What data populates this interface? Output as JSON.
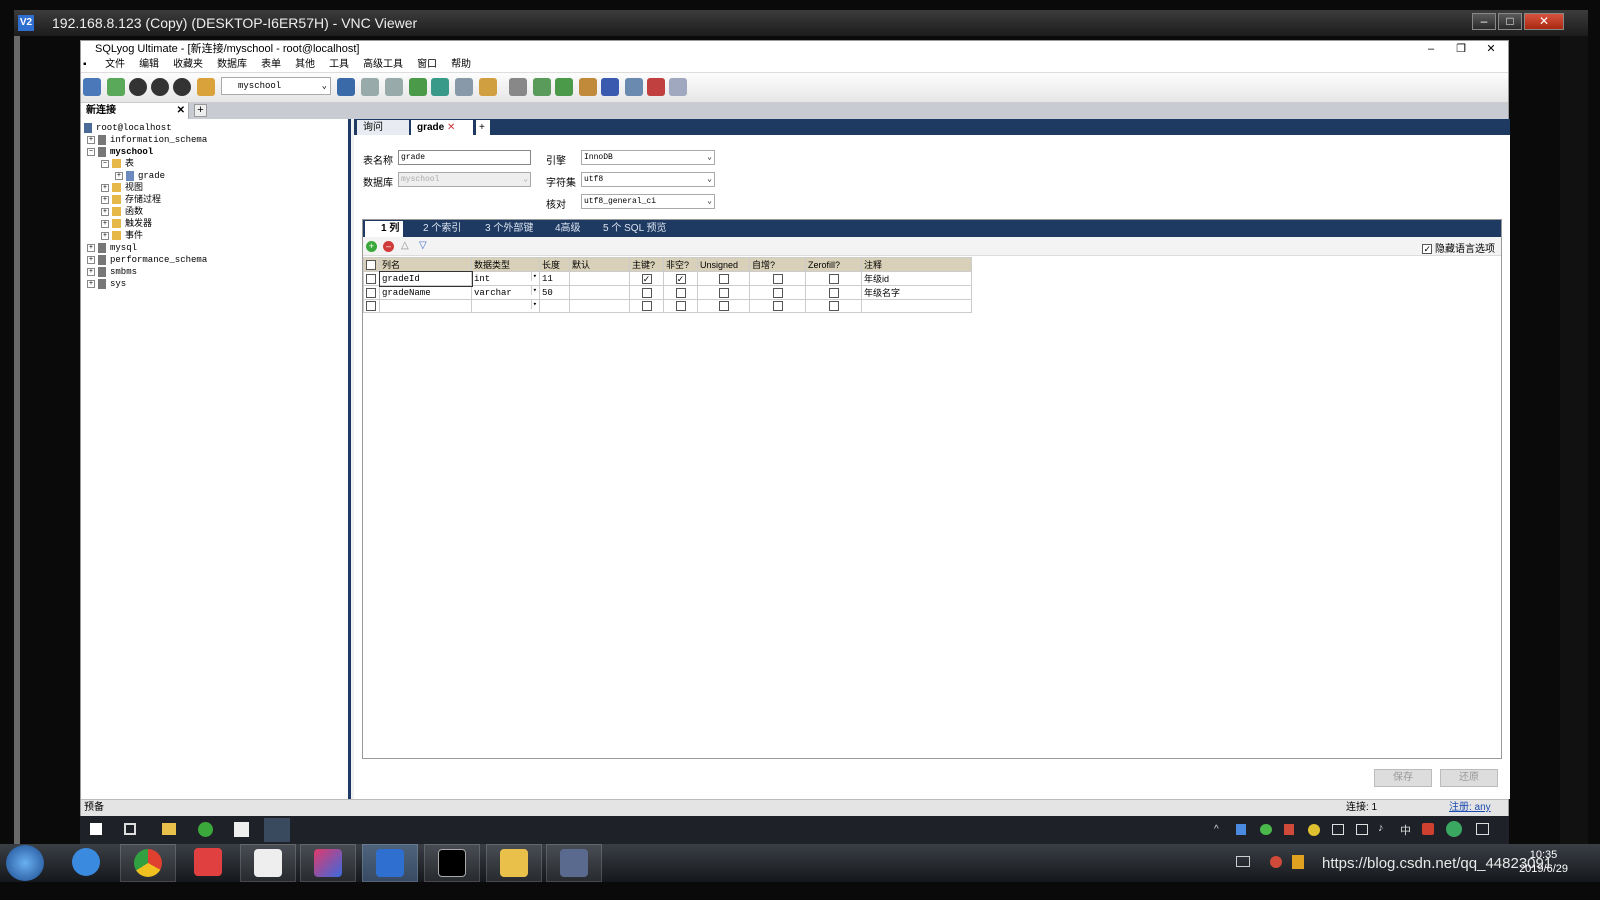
{
  "vnc": {
    "title": "192.168.8.123 (Copy) (DESKTOP-I6ER57H) - VNC Viewer",
    "icon": "V2"
  },
  "app": {
    "title": "SQLyog Ultimate - [新连接/myschool - root@localhost]",
    "menu": [
      "文件",
      "编辑",
      "收藏夹",
      "数据库",
      "表单",
      "其他",
      "工具",
      "高级工具",
      "窗口",
      "帮助"
    ],
    "db_selector": "myschool",
    "connection_tab": "新连接"
  },
  "tree": {
    "root": "root@localhost",
    "nodes": [
      {
        "label": "information_schema",
        "level": 1,
        "bold": false
      },
      {
        "label": "myschool",
        "level": 1,
        "bold": true
      },
      {
        "label": "表",
        "level": 2,
        "bold": false
      },
      {
        "label": "grade",
        "level": 3,
        "bold": false
      },
      {
        "label": "视图",
        "level": 2,
        "bold": false
      },
      {
        "label": "存储过程",
        "level": 2,
        "bold": false
      },
      {
        "label": "函数",
        "level": 2,
        "bold": false
      },
      {
        "label": "触发器",
        "level": 2,
        "bold": false
      },
      {
        "label": "事件",
        "level": 2,
        "bold": false
      },
      {
        "label": "mysql",
        "level": 1,
        "bold": false
      },
      {
        "label": "performance_schema",
        "level": 1,
        "bold": false
      },
      {
        "label": "smbms",
        "level": 1,
        "bold": false
      },
      {
        "label": "sys",
        "level": 1,
        "bold": false
      }
    ]
  },
  "query_tabs": [
    {
      "label": "询问"
    },
    {
      "label": "grade"
    }
  ],
  "form": {
    "table_name_label": "表名称",
    "table_name": "grade",
    "database_label": "数据库",
    "database": "myschool",
    "engine_label": "引擎",
    "engine": "InnoDB",
    "charset_label": "字符集",
    "charset": "utf8",
    "collation_label": "核对",
    "collation": "utf8_general_ci"
  },
  "subtabs": [
    "1 列",
    "2 个索引",
    "3 个外部键",
    "4高级",
    "5 个 SQL 预览"
  ],
  "hide_lang_option": "隐藏语言选项",
  "columns": {
    "headers": [
      "列名",
      "数据类型",
      "长度",
      "默认",
      "主键?",
      "非空?",
      "Unsigned",
      "自增?",
      "Zerofill?",
      "注释"
    ],
    "rows": [
      {
        "name": "gradeId",
        "type": "int",
        "length": "11",
        "default": "",
        "pk": true,
        "nn": true,
        "unsigned": false,
        "ai": false,
        "zf": false,
        "comment": "年级id"
      },
      {
        "name": "gradeName",
        "type": "varchar",
        "length": "50",
        "default": "",
        "pk": false,
        "nn": false,
        "unsigned": false,
        "ai": false,
        "zf": false,
        "comment": "年级名字"
      },
      {
        "name": "",
        "type": "",
        "length": "",
        "default": "",
        "pk": false,
        "nn": false,
        "unsigned": false,
        "ai": false,
        "zf": false,
        "comment": ""
      }
    ]
  },
  "buttons": {
    "save": "保存",
    "revert": "还原"
  },
  "status": {
    "left": "预备",
    "conn": "连接: 1",
    "register": "注册: any"
  },
  "clock": {
    "time": "10:35",
    "date": "2019/6/29"
  },
  "watermark": "https://blog.csdn.net/qq_44823091"
}
